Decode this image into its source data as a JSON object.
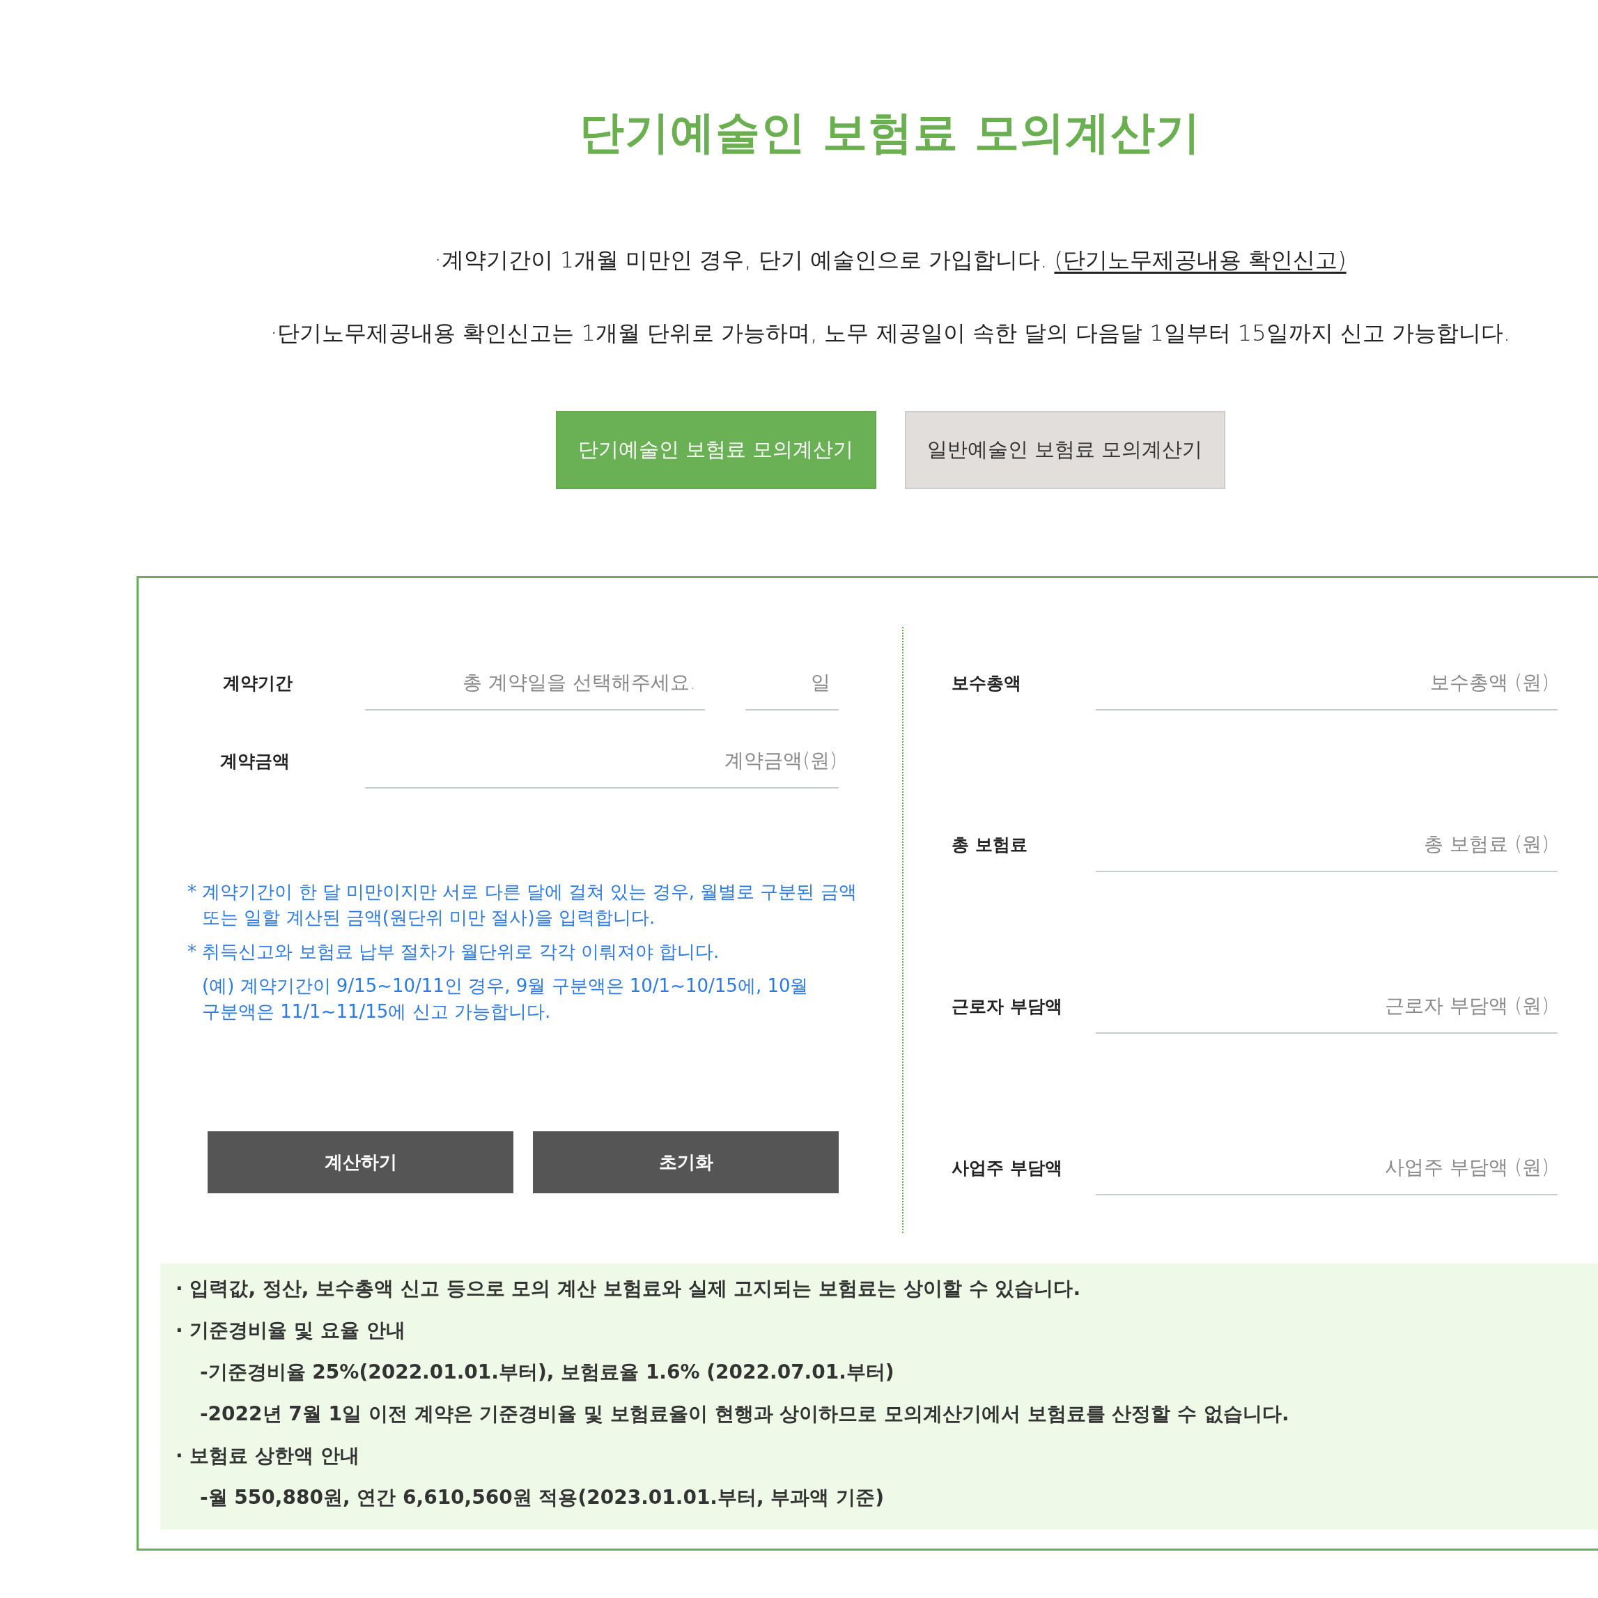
{
  "title": "단기예술인 보험료 모의계산기",
  "info": [
    {
      "text": "·계약기간이 1개월 미만인 경우, 단기 예술인으로 가입합니다.",
      "link": "(단기노무제공내용 확인신고)"
    },
    {
      "text": "·단기노무제공내용 확인신고는 1개월 단위로 가능하며, 노무 제공일이 속한 달의 다음달 1일부터 15일까지 신고 가능합니다."
    }
  ],
  "tabs": [
    {
      "label": "단기예술인 보험료 모의계산기",
      "selected": true
    },
    {
      "label": "일반예술인 보험료 모의계산기",
      "selected": false
    }
  ],
  "form": {
    "period": {
      "label": "계약기간",
      "placeholder": "총 계약일을 선택해주세요.",
      "unit_placeholder": "일"
    },
    "amount": {
      "label": "계약금액",
      "placeholder": "계약금액(원)"
    }
  },
  "notes": [
    {
      "kind": "note",
      "text": "* 계약기간이 한 달 미만이지만 서로 다른 달에 걸쳐 있는 경우, 월별로 구분된 금액 또는 일할 계산된 금액(원단위 미만 절사)을 입력합니다."
    },
    {
      "kind": "note",
      "text": "* 취득신고와 보험료 납부 절차가 월단위로 각각 이뤄져야 합니다."
    },
    {
      "kind": "example",
      "text": "(예) 계약기간이 9/15~10/11인 경우, 9월 구분액은 10/1~10/15에, 10월 구분액은 11/1~11/15에 신고 가능합니다."
    }
  ],
  "buttons": [
    "계산하기",
    "초기화"
  ],
  "results": [
    {
      "label": "보수총액",
      "placeholder": "보수총액 (원)"
    },
    {
      "label": "총 보험료",
      "placeholder": "총 보험료 (원)"
    },
    {
      "label": "근로자 부담액",
      "placeholder": "근로자 부담액 (원)"
    },
    {
      "label": "사업주 부담액",
      "placeholder": "사업주 부담액 (원)"
    }
  ],
  "notices": [
    {
      "text": "· 입력값, 정산, 보수총액 신고 등으로 모의 계산 보험료와 실제 고지되는 보험료는 상이할 수 있습니다."
    },
    {
      "text": "· 기준경비율 및 요율 안내",
      "children": [
        {
          "text": "-기준경비율 25%(2022.01.01.부터), 보험료율 1.6% (2022.07.01.부터)"
        },
        {
          "text": "-2022년 7월 1일 이전 계약은 기준경비율 및 보험료율이 현행과 상이하므로 모의계산기에서 보험료를 산정할 수 없습니다."
        }
      ]
    },
    {
      "text": "· 보험료 상한액 안내",
      "children": [
        {
          "text": "-월 550,880원, 연간 6,610,560원 적용(2023.01.01.부터, 부과액 기준)"
        }
      ]
    }
  ]
}
